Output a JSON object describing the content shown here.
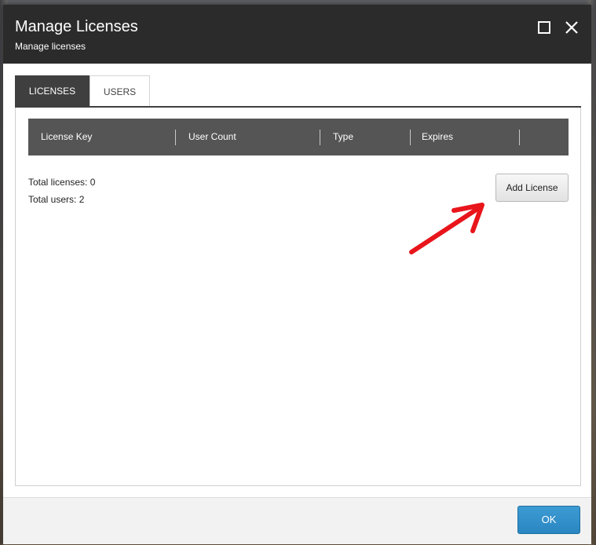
{
  "dialog": {
    "title": "Manage Licenses",
    "subtitle": "Manage licenses",
    "controls": {
      "maximize_icon": "maximize-icon",
      "close_icon": "close-icon"
    }
  },
  "tabs": [
    {
      "label": "LICENSES",
      "active": true
    },
    {
      "label": "USERS",
      "active": false
    }
  ],
  "grid": {
    "columns": [
      "License Key",
      "User Count",
      "Type",
      "Expires"
    ],
    "rows": []
  },
  "stats": {
    "total_licenses": "Total licenses: 0",
    "total_users": "Total users: 2"
  },
  "actions": {
    "add_license_label": "Add License"
  },
  "annotation": {
    "icon": "red-arrow-icon",
    "color": "#e8151b"
  },
  "footer": {
    "ok_label": "OK"
  },
  "colors": {
    "titlebar": "#2b2b2b",
    "active_tab": "#3f3f3f",
    "grid_header": "#555555",
    "ok_button": "#2f8dca"
  }
}
